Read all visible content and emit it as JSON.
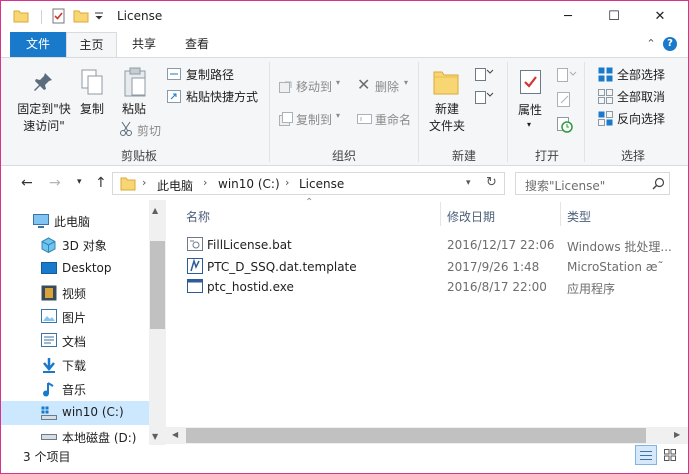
{
  "window": {
    "title": "License",
    "controls": {
      "minimize": "─",
      "maximize": "☐",
      "close": "✕"
    }
  },
  "ribbon_tabs": {
    "file": "文件",
    "items": [
      "主页",
      "共享",
      "查看"
    ],
    "active": "主页"
  },
  "ribbon": {
    "clipboard": {
      "pin_label_1": "固定到\"快",
      "pin_label_2": "速访问\"",
      "copy": "复制",
      "paste": "粘贴",
      "copy_path": "复制路径",
      "paste_shortcut": "粘贴快捷方式",
      "cut": "剪切",
      "group": "剪贴板"
    },
    "organize": {
      "move_to": "移动到",
      "copy_to": "复制到",
      "delete": "删除",
      "rename": "重命名",
      "group": "组织"
    },
    "new": {
      "new_folder_1": "新建",
      "new_folder_2": "文件夹",
      "group": "新建"
    },
    "open": {
      "properties": "属性",
      "group": "打开"
    },
    "select": {
      "select_all": "全部选择",
      "select_none": "全部取消",
      "invert": "反向选择",
      "group": "选择"
    }
  },
  "address": {
    "segments": [
      "此电脑",
      "win10 (C:)",
      "License"
    ],
    "search_placeholder": "搜索\"License\""
  },
  "sidebar": {
    "items": [
      {
        "label": "此电脑",
        "icon": "pc-icon"
      },
      {
        "label": "3D 对象",
        "icon": "3d-objects-icon"
      },
      {
        "label": "Desktop",
        "icon": "desktop-icon"
      },
      {
        "label": "视频",
        "icon": "video-icon"
      },
      {
        "label": "图片",
        "icon": "pictures-icon"
      },
      {
        "label": "文档",
        "icon": "documents-icon"
      },
      {
        "label": "下载",
        "icon": "download-icon"
      },
      {
        "label": "音乐",
        "icon": "music-icon"
      },
      {
        "label": "win10 (C:)",
        "icon": "drive-icon"
      },
      {
        "label": "本地磁盘 (D:)",
        "icon": "drive-icon"
      }
    ],
    "selected": "win10 (C:)"
  },
  "file_list": {
    "columns": [
      "名称",
      "修改日期",
      "类型"
    ],
    "rows": [
      {
        "name": "FillLicense.bat",
        "date": "2016/12/17 22:06",
        "type": "Windows 批处理...",
        "icon": "batch-file-icon"
      },
      {
        "name": "PTC_D_SSQ.dat.template",
        "date": "2017/9/26 1:48",
        "type": "MicroStation æ˜",
        "icon": "microstation-file-icon"
      },
      {
        "name": "ptc_hostid.exe",
        "date": "2016/8/17 22:00",
        "type": "应用程序",
        "icon": "exe-file-icon"
      }
    ]
  },
  "status": {
    "item_count": "3 个项目"
  },
  "colors": {
    "accent": "#1979ca",
    "selection": "#cce8ff",
    "border": "#d9328a"
  }
}
